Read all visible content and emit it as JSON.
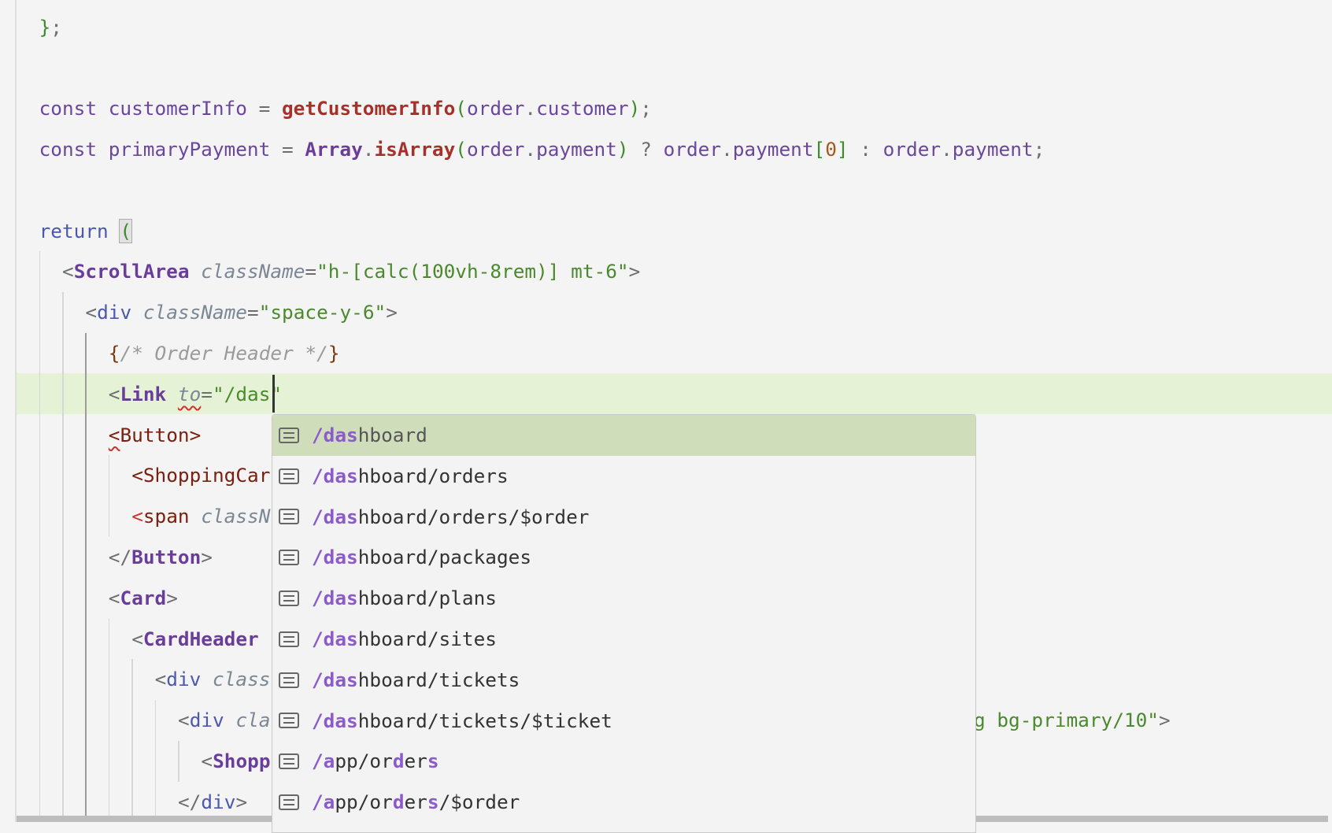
{
  "editor": {
    "code_lines": [
      {
        "indent": 0,
        "tokens": [
          [
            "b",
            "}"
          ],
          [
            "p",
            ";"
          ]
        ]
      },
      {
        "indent": 0,
        "tokens": []
      },
      {
        "indent": 0,
        "tokens": [
          [
            "v",
            "const customerInfo "
          ],
          [
            "p",
            "= "
          ],
          [
            "f",
            "getCustomerInfo"
          ],
          [
            "b",
            "("
          ],
          [
            "v",
            "order"
          ],
          [
            "p",
            "."
          ],
          [
            "v",
            "customer"
          ],
          [
            "b",
            ")"
          ],
          [
            "p",
            ";"
          ]
        ]
      },
      {
        "indent": 0,
        "tokens": [
          [
            "v",
            "const primaryPayment "
          ],
          [
            "p",
            "= "
          ],
          [
            "cl",
            "Array"
          ],
          [
            "p",
            "."
          ],
          [
            "f",
            "isArray"
          ],
          [
            "b",
            "("
          ],
          [
            "v",
            "order"
          ],
          [
            "p",
            "."
          ],
          [
            "v",
            "payment"
          ],
          [
            "b",
            ")"
          ],
          [
            "p",
            " ? "
          ],
          [
            "v",
            "order"
          ],
          [
            "p",
            "."
          ],
          [
            "v",
            "payment"
          ],
          [
            "b",
            "["
          ],
          [
            "n",
            "0"
          ],
          [
            "b",
            "]"
          ],
          [
            "p",
            " : "
          ],
          [
            "v",
            "order"
          ],
          [
            "p",
            "."
          ],
          [
            "v",
            "payment"
          ],
          [
            "p",
            ";"
          ]
        ]
      },
      {
        "indent": 0,
        "tokens": []
      },
      {
        "indent": 0,
        "tokens": [
          [
            "k",
            "return "
          ],
          [
            "b bm",
            "("
          ]
        ]
      },
      {
        "indent": 2,
        "tokens": [
          [
            "p",
            "<"
          ],
          [
            "t",
            "ScrollArea"
          ],
          [
            "p",
            " "
          ],
          [
            "a",
            "className"
          ],
          [
            "p",
            "="
          ],
          [
            "s",
            "\"h-[calc(100vh-8rem)] mt-6\""
          ],
          [
            "p",
            ">"
          ]
        ]
      },
      {
        "indent": 4,
        "tokens": [
          [
            "p",
            "<"
          ],
          [
            "h",
            "div"
          ],
          [
            "p",
            " "
          ],
          [
            "a",
            "className"
          ],
          [
            "p",
            "="
          ],
          [
            "s",
            "\"space-y-6\""
          ],
          [
            "p",
            ">"
          ]
        ]
      },
      {
        "indent": 6,
        "tokens": [
          [
            "cb",
            "{"
          ],
          [
            "c",
            "/* Order Header */"
          ],
          [
            "cb",
            "}"
          ]
        ]
      },
      {
        "indent": 6,
        "tokens": [
          [
            "p",
            "<"
          ],
          [
            "t",
            "Link"
          ],
          [
            "p",
            " "
          ],
          [
            "a sq",
            "to"
          ],
          [
            "p",
            "="
          ],
          [
            "s",
            "\"/das\""
          ]
        ]
      },
      {
        "indent": 6,
        "tokens": [
          [
            "tr sq",
            "<"
          ],
          [
            "tr",
            "Button"
          ],
          [
            "tr",
            ">"
          ]
        ]
      },
      {
        "indent": 8,
        "tokens": [
          [
            "tr",
            "<ShoppingCar"
          ]
        ]
      },
      {
        "indent": 8,
        "tokens": [
          [
            "e",
            "<"
          ],
          [
            "tr",
            "span"
          ],
          [
            "p",
            " "
          ],
          [
            "a",
            "classN"
          ]
        ]
      },
      {
        "indent": 6,
        "tokens": [
          [
            "p",
            "</"
          ],
          [
            "t",
            "Button"
          ],
          [
            "p",
            ">"
          ]
        ]
      },
      {
        "indent": 6,
        "tokens": [
          [
            "p",
            "<"
          ],
          [
            "t",
            "Card"
          ],
          [
            "p",
            ">"
          ]
        ]
      },
      {
        "indent": 8,
        "tokens": [
          [
            "p",
            "<"
          ],
          [
            "t",
            "CardHeader"
          ]
        ]
      },
      {
        "indent": 10,
        "tokens": [
          [
            "p",
            "<"
          ],
          [
            "h",
            "div"
          ],
          [
            "p",
            " "
          ],
          [
            "a",
            "class"
          ]
        ]
      },
      {
        "indent": 12,
        "tokens": [
          [
            "p",
            "<"
          ],
          [
            "h",
            "div"
          ],
          [
            "p",
            " "
          ],
          [
            "a",
            "cla"
          ]
        ],
        "tail": [
          [
            "s",
            "g bg-primary/10\""
          ],
          [
            "p",
            ">"
          ]
        ]
      },
      {
        "indent": 14,
        "tokens": [
          [
            "p",
            "<"
          ],
          [
            "t",
            "Shopp"
          ]
        ]
      },
      {
        "indent": 12,
        "tokens": [
          [
            "p",
            "</"
          ],
          [
            "h",
            "div"
          ],
          [
            "p",
            ">"
          ]
        ]
      }
    ]
  },
  "autocomplete": {
    "selected_index": 0,
    "icon": "text-entry-icon",
    "items": [
      [
        [
          "m",
          "/das"
        ],
        [
          "u",
          "hboard"
        ]
      ],
      [
        [
          "m",
          "/das"
        ],
        [
          "u",
          "hboard/orders"
        ]
      ],
      [
        [
          "m",
          "/das"
        ],
        [
          "u",
          "hboard/orders/$order"
        ]
      ],
      [
        [
          "m",
          "/das"
        ],
        [
          "u",
          "hboard/packages"
        ]
      ],
      [
        [
          "m",
          "/das"
        ],
        [
          "u",
          "hboard/plans"
        ]
      ],
      [
        [
          "m",
          "/das"
        ],
        [
          "u",
          "hboard/sites"
        ]
      ],
      [
        [
          "m",
          "/das"
        ],
        [
          "u",
          "hboard/tickets"
        ]
      ],
      [
        [
          "m",
          "/das"
        ],
        [
          "u",
          "hboard/tickets/$ticket"
        ]
      ],
      [
        [
          "m",
          "/a"
        ],
        [
          "u",
          "pp/or"
        ],
        [
          "m",
          "d"
        ],
        [
          "u",
          "er"
        ],
        [
          "m",
          "s"
        ]
      ],
      [
        [
          "m",
          "/a"
        ],
        [
          "u",
          "pp/or"
        ],
        [
          "m",
          "d"
        ],
        [
          "u",
          "er"
        ],
        [
          "m",
          "s"
        ],
        [
          "u",
          "/$order"
        ]
      ]
    ]
  }
}
